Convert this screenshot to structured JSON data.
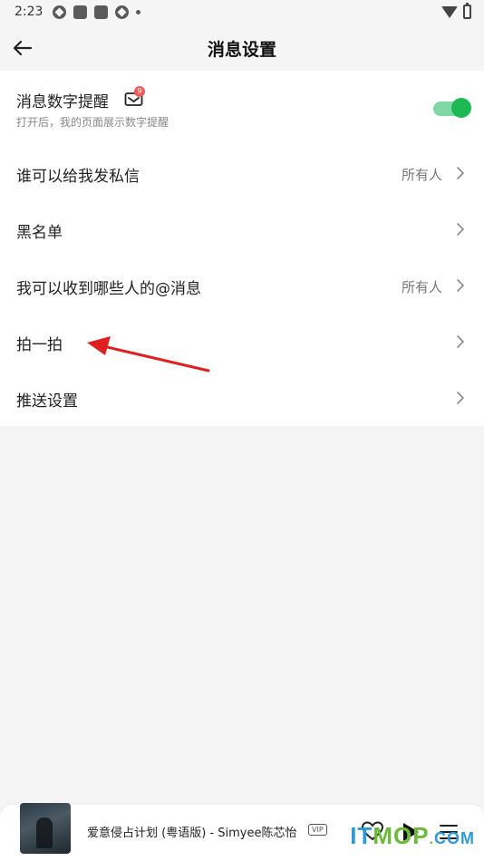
{
  "status_bar": {
    "time": "2:23"
  },
  "header": {
    "title": "消息设置"
  },
  "settings": {
    "message_badge": {
      "label": "消息数字提醒",
      "description": "打开后，我的页面展示数字提醒",
      "badge_count": "9",
      "enabled": true
    },
    "rows": [
      {
        "label": "谁可以给我发私信",
        "value": "所有人"
      },
      {
        "label": "黑名单",
        "value": ""
      },
      {
        "label": "我可以收到哪些人的@消息",
        "value": "所有人"
      },
      {
        "label": "拍一拍",
        "value": ""
      },
      {
        "label": "推送设置",
        "value": ""
      }
    ]
  },
  "player": {
    "song": "爱意侵占计划 (粤语版) - Simyee陈芯怡",
    "vip_label": "VIP"
  },
  "colors": {
    "toggle_on": "#1db954",
    "badge": "#f15b5b",
    "annotation_arrow": "#e02020"
  },
  "watermark": {
    "brand_it": "IT",
    "brand_mop": "MOP",
    "dot": ".",
    "tld": "COM"
  }
}
